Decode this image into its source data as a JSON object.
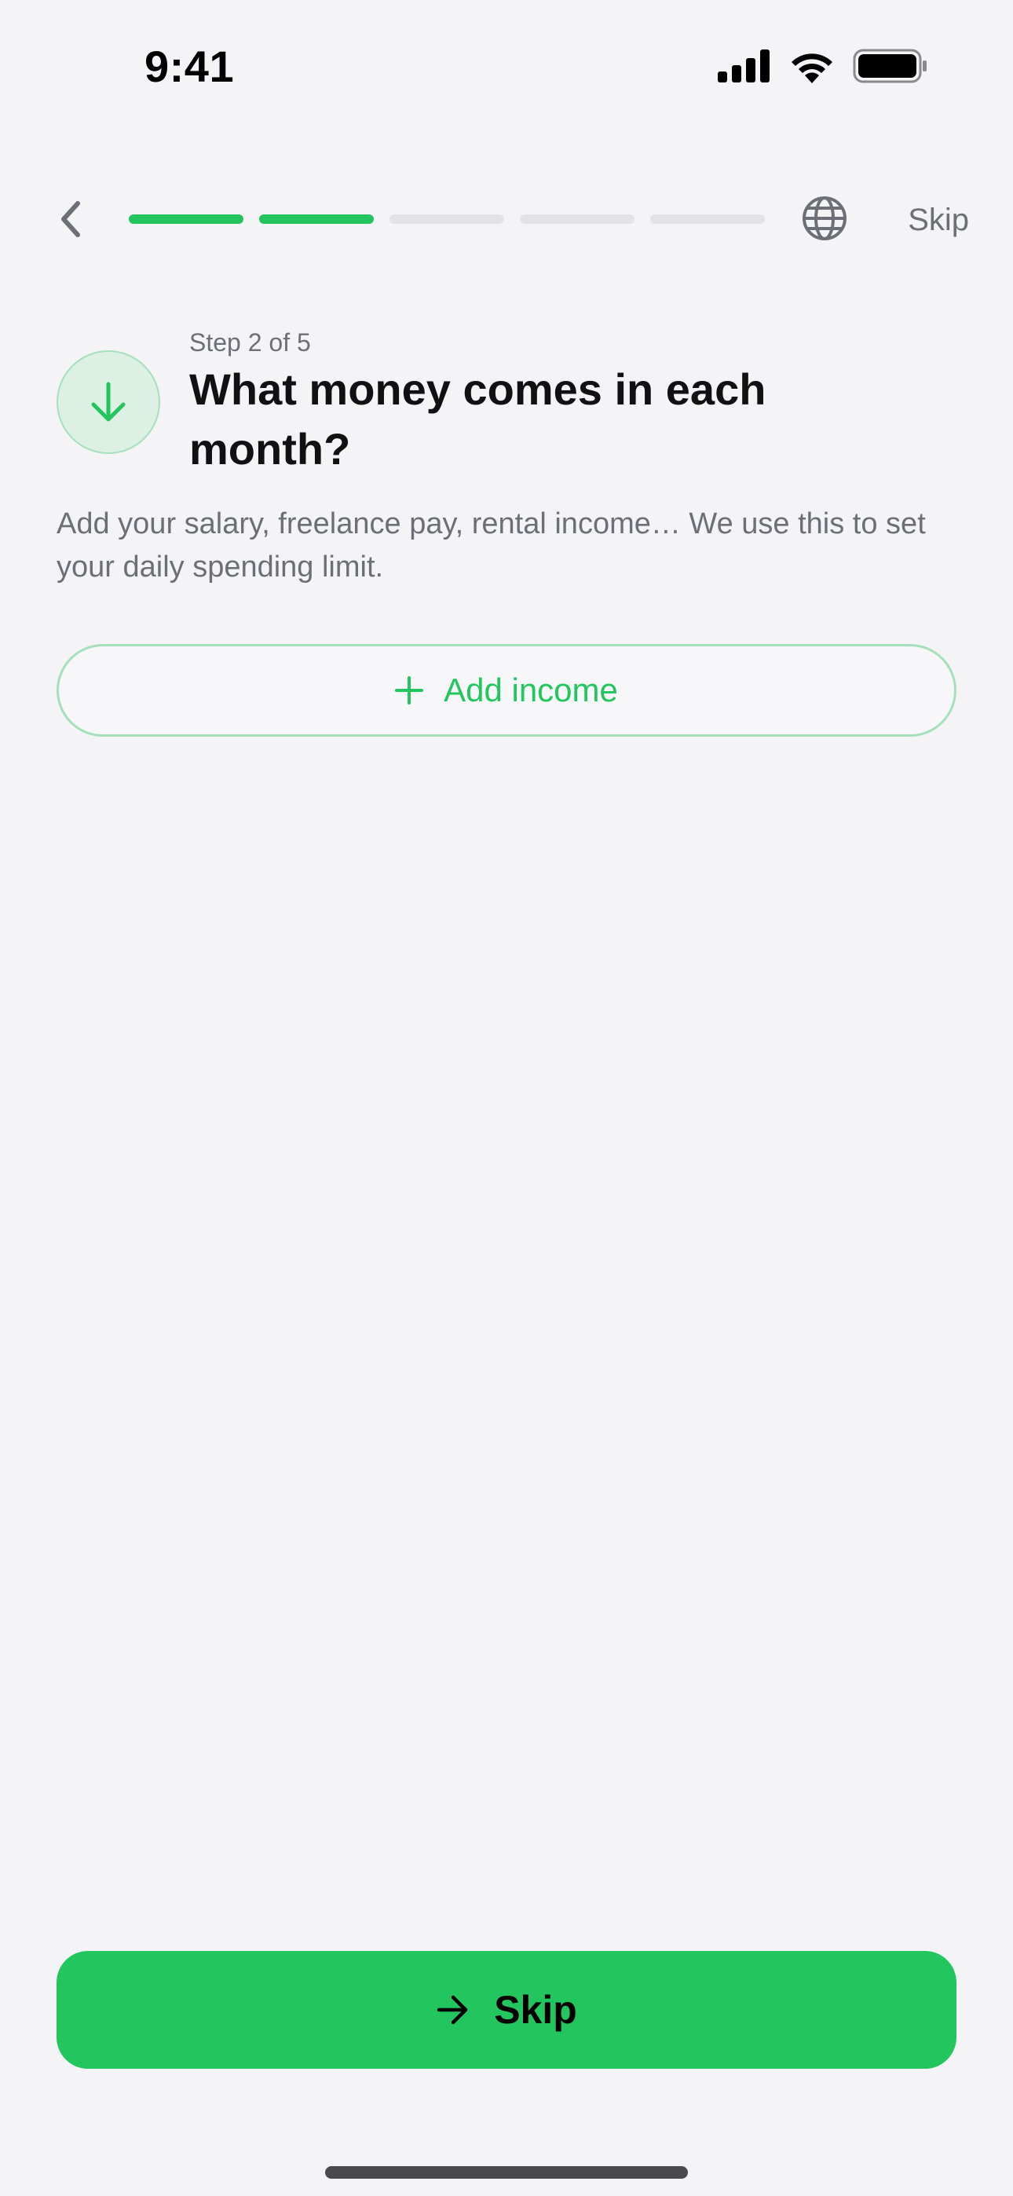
{
  "status_bar": {
    "time": "9:41",
    "icons": [
      "signal-icon",
      "wifi-icon",
      "battery-icon"
    ]
  },
  "nav": {
    "back_icon": "chevron-left-icon",
    "progress": {
      "total_steps": 5,
      "completed_steps": 2
    },
    "language_icon": "globe-icon",
    "skip_label": "Skip"
  },
  "header": {
    "icon": "arrow-down-icon",
    "step_label": "Step 2 of 5",
    "title": "What money comes in each month?",
    "description": "Add your salary, freelance pay, rental income… We use this to set your daily spending limit."
  },
  "add_income": {
    "icon": "plus-icon",
    "label": "Add income"
  },
  "footer": {
    "cta_icon": "arrow-right-icon",
    "cta_label": "Skip"
  },
  "colors": {
    "accent": "#22c55e",
    "accent_soft": "#dcf0e3",
    "background": "#f4f4f7",
    "muted_text": "#6e6e76"
  }
}
